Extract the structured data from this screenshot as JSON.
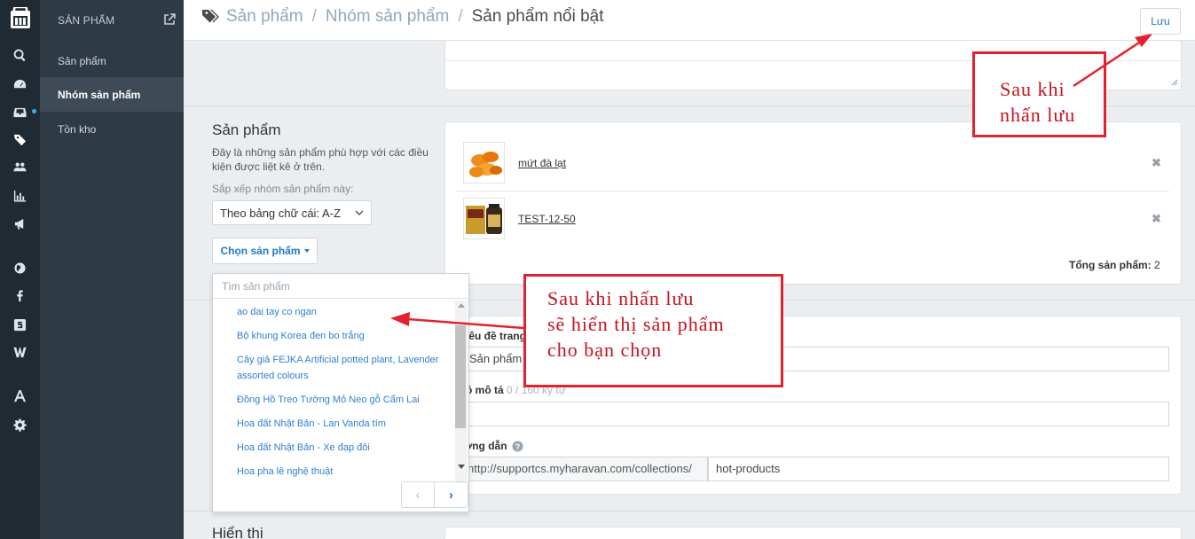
{
  "nav": {
    "section_title": "SẢN PHẨM",
    "items": [
      {
        "label": "Sản phẩm"
      },
      {
        "label": "Nhóm sản phẩm"
      },
      {
        "label": "Tồn kho"
      }
    ],
    "rail_icons": [
      "search-icon",
      "dashboard-icon",
      "inbox-icon",
      "tag-icon",
      "customers-icon",
      "reports-icon",
      "megaphone-icon",
      "globe-icon",
      "facebook-icon",
      "s-icon",
      "w-icon",
      "apps-icon",
      "settings-icon"
    ]
  },
  "header": {
    "breadcrumb": [
      "Sản phẩm",
      "Nhóm sản phẩm"
    ],
    "current": "Sản phẩm nổi bật",
    "save_label": "Lưu"
  },
  "products_section": {
    "title": "Sản phẩm",
    "description": "Đây là những sản phẩm phù hợp với các điều kiện được liệt kê ở trên.",
    "sort_label": "Sắp xếp nhóm sản phẩm này:",
    "sort_value": "Theo bảng chữ cái: A-Z",
    "choose_label": "Chọn sản phẩm",
    "search_placeholder": "Tìm sản phẩm",
    "options": [
      "ao dai tay co ngan",
      "Bộ khung Korea đen bo trắng",
      "Cây giả FEJKA Artificial potted plant, Lavender assorted colours",
      "Đồng Hồ Treo Tường Mỏ Neo gỗ Cẩm Lai",
      "Hoa đất Nhật Bản - Lan Vanda tím",
      "Hoa đất Nhật Bản - Xe đạp đôi",
      "Hoa pha lê nghệ thuật"
    ],
    "selected_products": [
      {
        "name": "mứt đà lạt"
      },
      {
        "name": "TEST-12-50"
      }
    ],
    "total_label": "Tổng sản phẩm:",
    "total_value": "2"
  },
  "seo": {
    "title_label": "iêu đề trang",
    "title_value": "Sản phẩm nổ",
    "desc_label": "ô mô tả",
    "desc_counter": "0 / 160 ký tự",
    "url_label": "ường dẫn",
    "url_prefix": "http://supportcs.myharavan.com/collections/",
    "url_handle": "hot-products"
  },
  "display_section": {
    "title": "Hiển thị"
  },
  "annotations": {
    "save_note": [
      "Sau khi",
      "nhấn lưu"
    ],
    "list_note": [
      "Sau khi nhấn lưu",
      "sẽ hiển thị sản phẩm",
      "cho bạn chọn"
    ]
  },
  "colors": {
    "accent": "#2277c9",
    "annotation": "#e4222f",
    "sidebar": "#202a33"
  }
}
